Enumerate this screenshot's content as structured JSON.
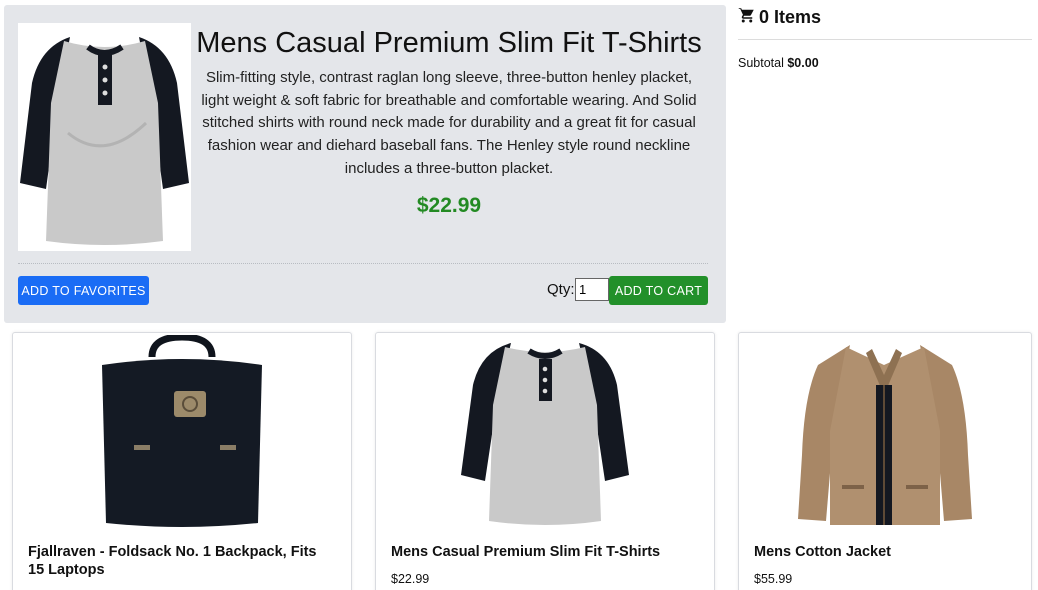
{
  "featured": {
    "title": "Mens Casual Premium Slim Fit T-Shirts",
    "description": "Slim-fitting style, contrast raglan long sleeve, three-button henley placket, light weight & soft fabric for breathable and comfortable wearing. And Solid stitched shirts with round neck made for durability and a great fit for casual fashion wear and diehard baseball fans. The Henley style round neckline includes a three-button placket.",
    "price": "$22.99",
    "favorites_label": "ADD TO FAVORITES",
    "qty_label": "Qty:",
    "qty_value": "1",
    "cart_label": "ADD TO CART",
    "image_icon": "henley-shirt-image"
  },
  "cart": {
    "icon": "cart-icon",
    "title": "0 Items",
    "subtotal_label": "Subtotal",
    "subtotal_value": "$0.00"
  },
  "products": [
    {
      "title": "Fjallraven - Foldsack No. 1 Backpack, Fits 15 Laptops",
      "price": "",
      "image_icon": "backpack-image"
    },
    {
      "title": "Mens Casual Premium Slim Fit T-Shirts",
      "price": "$22.99",
      "image_icon": "henley-shirt-image"
    },
    {
      "title": "Mens Cotton Jacket",
      "price": "$55.99",
      "image_icon": "jacket-image"
    }
  ],
  "colors": {
    "panel_bg": "#e4e6ea",
    "price_green": "#238a23",
    "favorites_blue": "#1a6cf5",
    "cart_green": "#22902a"
  }
}
